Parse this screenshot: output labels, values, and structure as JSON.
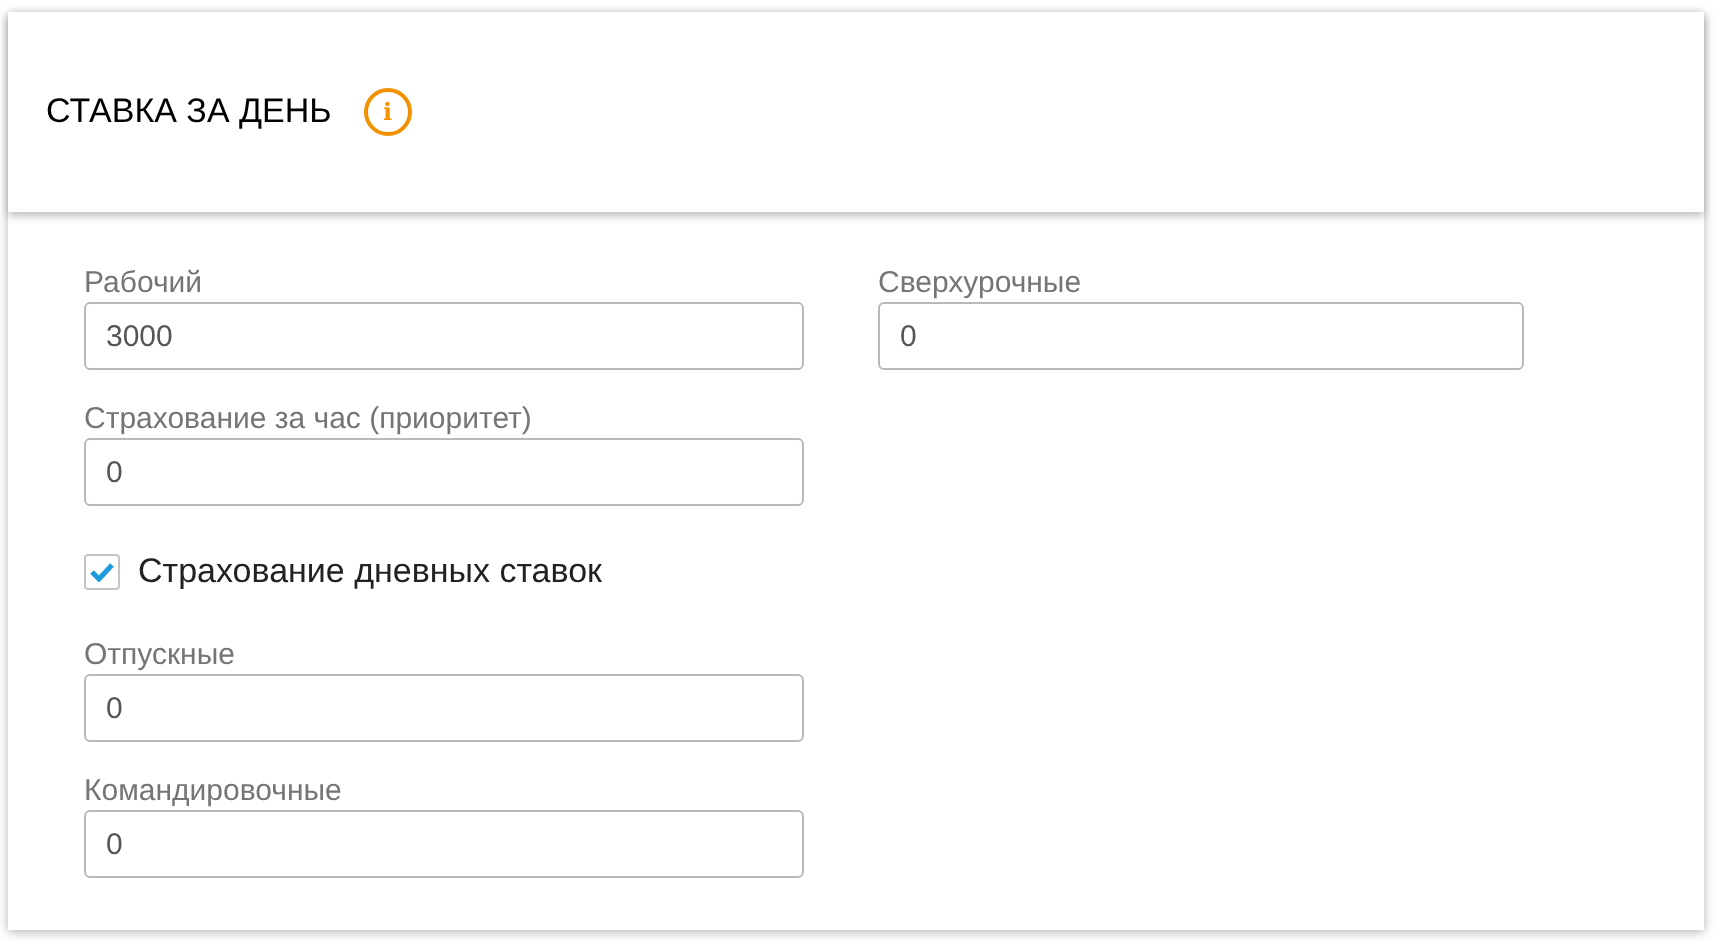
{
  "header": {
    "title": "СТАВКА ЗА ДЕНЬ",
    "info_icon": "i"
  },
  "left_column": [
    {
      "kind": "field",
      "label": "Рабочий",
      "value": "3000"
    },
    {
      "kind": "field",
      "label": "Страхование за час (приоритет)",
      "value": "0"
    },
    {
      "kind": "checkbox",
      "label": "Страхование дневных ставок",
      "checked": true
    },
    {
      "kind": "field",
      "label": "Отпускные",
      "value": "0"
    },
    {
      "kind": "field",
      "label": "Командировочные",
      "value": "0"
    }
  ],
  "right_column": [
    {
      "kind": "field",
      "label": "Сверхурочные",
      "value": "0"
    }
  ]
}
